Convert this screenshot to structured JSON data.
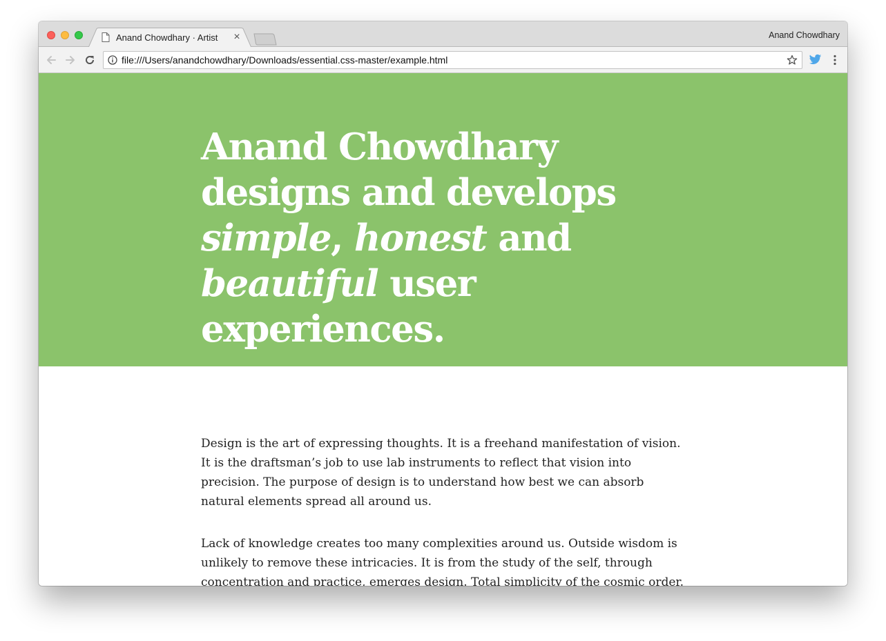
{
  "browser": {
    "tab_title": "Anand Chowdhary · Artist",
    "profile_name": "Anand Chowdhary",
    "url": "file:///Users/anandchowdhary/Downloads/essential.css-master/example.html",
    "icons": [
      "close-traffic-light",
      "minimize-traffic-light",
      "zoom-traffic-light",
      "document-icon",
      "close-icon",
      "back-arrow-icon",
      "forward-arrow-icon",
      "reload-icon",
      "info-icon",
      "star-icon",
      "twitter-icon",
      "menu-icon"
    ]
  },
  "hero": {
    "background_color": "#8bc36b",
    "heading_part1": "Anand Chowdhary designs and develops ",
    "heading_em1": "simple",
    "heading_part2": ", ",
    "heading_em2": "honest",
    "heading_part3": " and ",
    "heading_em3": "beautiful",
    "heading_part4": " user experiences."
  },
  "content": {
    "paragraphs": [
      "Design is the art of expressing thoughts. It is a freehand manifestation of vision. It is the draftsman’s job to use lab instruments to reflect that vision into precision. The purpose of design is to understand how best we can absorb natural elements spread all around us.",
      "Lack of knowledge creates too many complexities around us. Outside wisdom is unlikely to remove these intricacies. It is from the study of the self, through concentration and practice, emerges design. Total simplicity of the cosmic order."
    ]
  }
}
